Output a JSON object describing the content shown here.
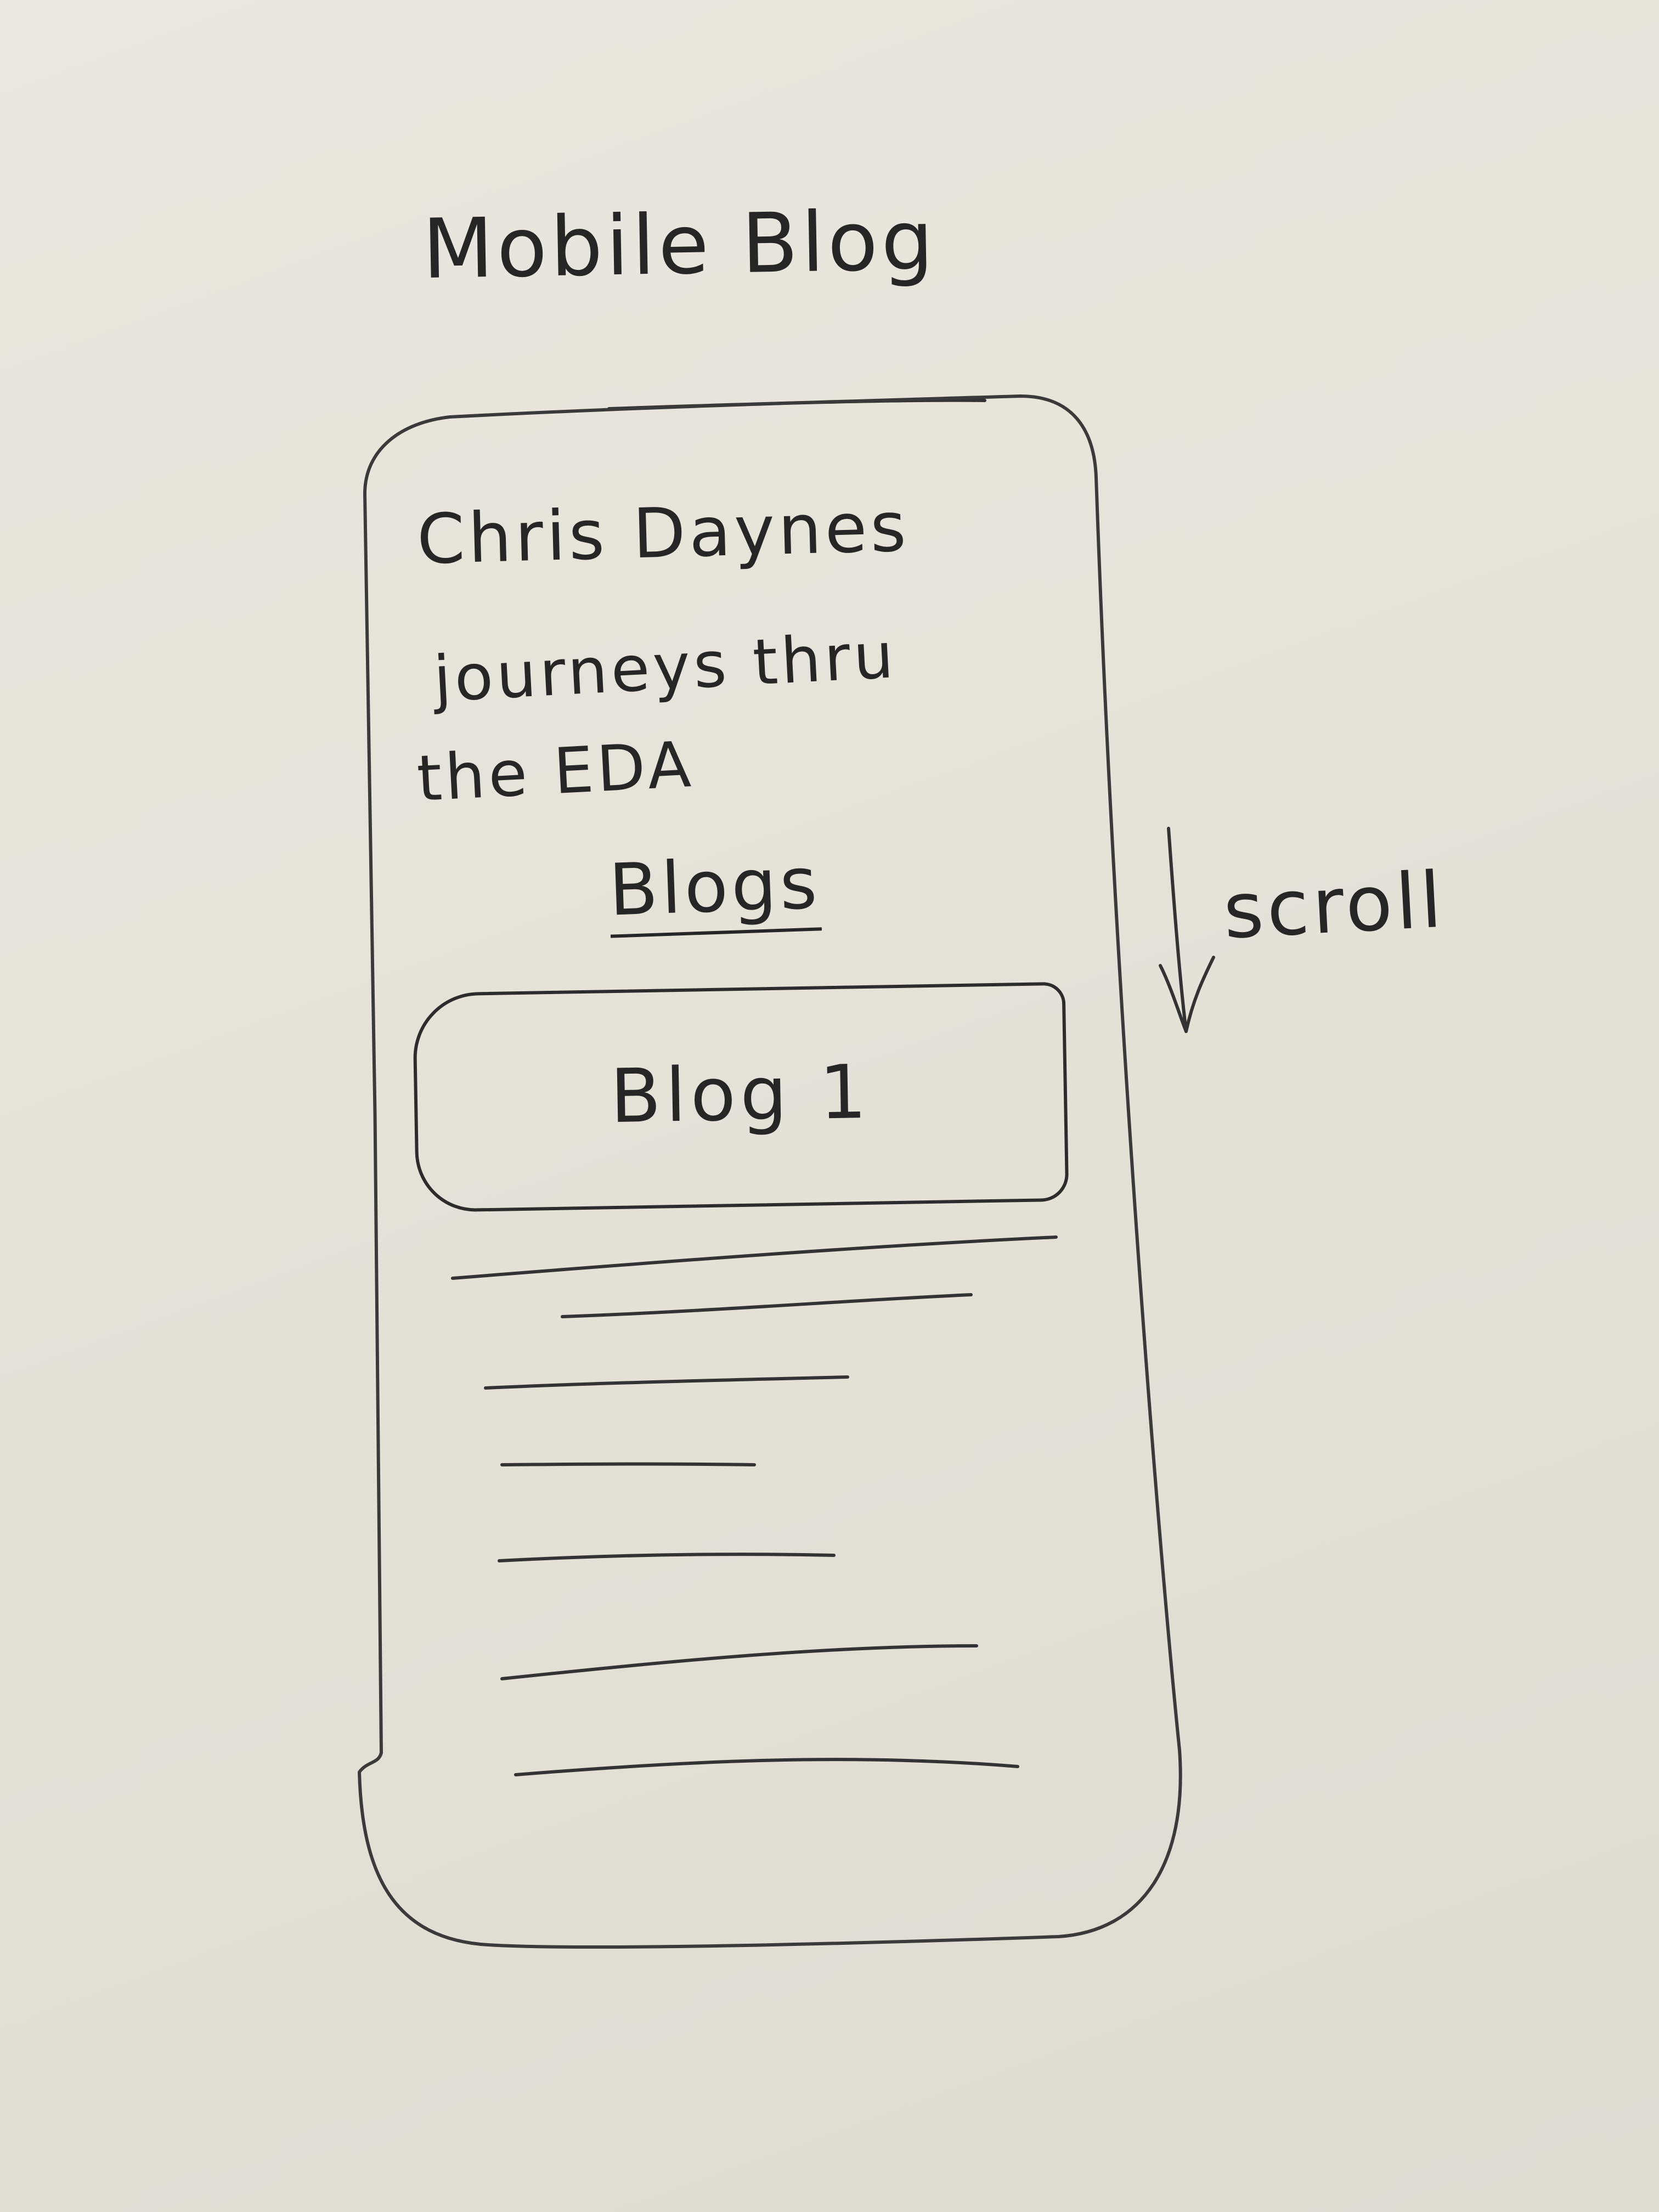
{
  "page": {
    "title": "Mobile Blog"
  },
  "screen": {
    "header_title": "Chris Daynes",
    "header_subtitle_line1": "journeys thru",
    "header_subtitle_line2": "the EDA",
    "section_heading": "Blogs",
    "blog_card": {
      "title": "Blog 1"
    },
    "text_line_count": 7
  },
  "annotation": {
    "scroll_label": "scroll",
    "arrow_icon": "down-arrow-icon"
  },
  "colors": {
    "paper": "#e8e5dc",
    "ink": "#2a2a2a"
  }
}
